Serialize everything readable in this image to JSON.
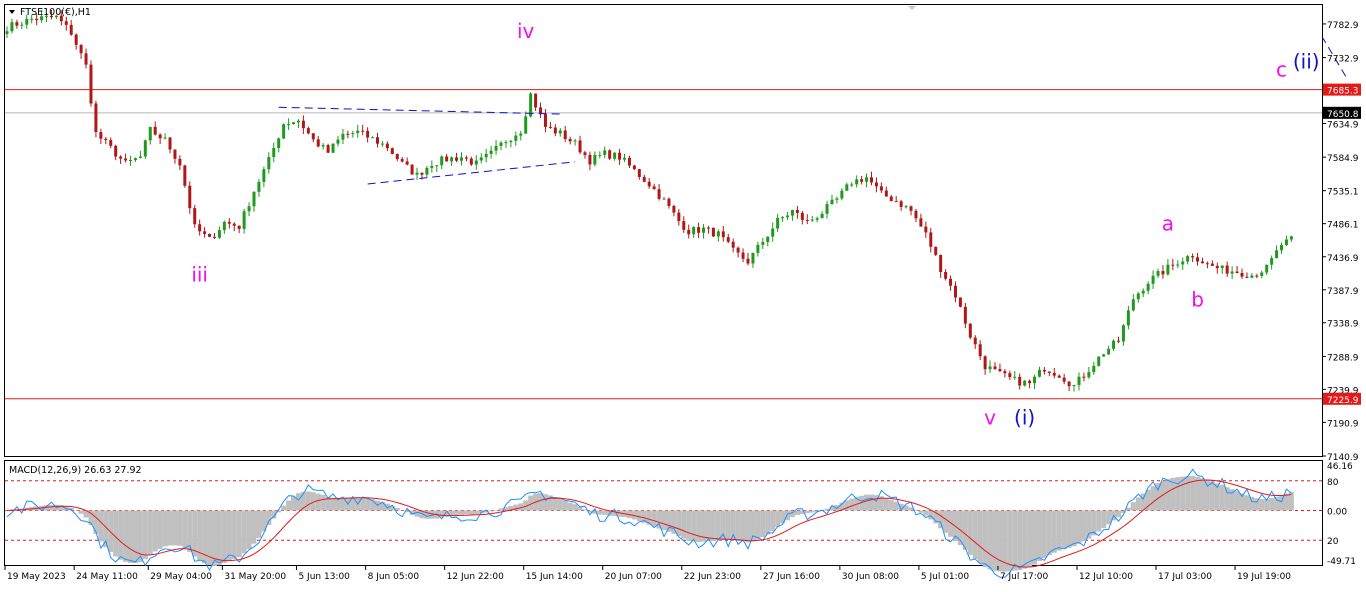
{
  "window": {
    "symbol_label": "FTSE100(€),H1",
    "colors": {
      "background": "#ffffff",
      "frame": "#000000",
      "bull_candle": "#1f9a1f",
      "bear_candle": "#b01818",
      "hline": "#e31a1a",
      "price_line": "#b8b8b8",
      "wave_minor": "#ee10ee",
      "wave_intermediate": "#1010c8",
      "trendline": "#1010c8"
    }
  },
  "chart_data": [
    {
      "type": "candlestick",
      "title": "FTSE100(€),H1",
      "ylim": [
        7140.9,
        7811.0
      ],
      "y_ticks": [
        "7782.9",
        "7732.9",
        "7685.3",
        "7650.8",
        "7634.9",
        "7584.9",
        "7535.1",
        "7486.1",
        "7436.9",
        "7387.9",
        "7338.9",
        "7288.9",
        "7239.9",
        "7225.9",
        "7190.9",
        "7140.9"
      ],
      "price_labels": [
        {
          "value": 7685.3,
          "text": "7685.3",
          "style": "red"
        },
        {
          "value": 7650.8,
          "text": "7650.8",
          "style": "black"
        },
        {
          "value": 7225.9,
          "text": "7225.9",
          "style": "red"
        }
      ],
      "x_tick_labels": [
        "19 May 2023",
        "24 May 11:00",
        "29 May 04:00",
        "31 May 20:00",
        "5 Jun 13:00",
        "8 Jun 05:00",
        "12 Jun 22:00",
        "15 Jun 14:00",
        "20 Jun 07:00",
        "22 Jun 23:00",
        "27 Jun 16:00",
        "30 Jun 08:00",
        "5 Jul 01:00",
        "7 Jul 17:00",
        "12 Jul 10:00",
        "17 Jul 03:00",
        "19 Jul 19:00"
      ],
      "x_tick_index": [
        0,
        14,
        29,
        44,
        59,
        73,
        89,
        105,
        121,
        137,
        153,
        169,
        185,
        201,
        217,
        233,
        249
      ],
      "bar_count": 261,
      "price_path": [
        [
          0,
          7778
        ],
        [
          5,
          7790
        ],
        [
          10,
          7793
        ],
        [
          13,
          7770
        ],
        [
          16,
          7720
        ],
        [
          18,
          7620
        ],
        [
          21,
          7598
        ],
        [
          24,
          7575
        ],
        [
          27,
          7585
        ],
        [
          29,
          7625
        ],
        [
          32,
          7610
        ],
        [
          35,
          7575
        ],
        [
          38,
          7480
        ],
        [
          41,
          7462
        ],
        [
          44,
          7488
        ],
        [
          47,
          7482
        ],
        [
          50,
          7535
        ],
        [
          53,
          7580
        ],
        [
          56,
          7635
        ],
        [
          59,
          7640
        ],
        [
          62,
          7610
        ],
        [
          65,
          7592
        ],
        [
          68,
          7618
        ],
        [
          71,
          7622
        ],
        [
          74,
          7612
        ],
        [
          77,
          7600
        ],
        [
          80,
          7575
        ],
        [
          83,
          7558
        ],
        [
          86,
          7576
        ],
        [
          89,
          7582
        ],
        [
          92,
          7585
        ],
        [
          95,
          7575
        ],
        [
          98,
          7590
        ],
        [
          101,
          7610
        ],
        [
          104,
          7625
        ],
        [
          106,
          7678
        ],
        [
          109,
          7630
        ],
        [
          112,
          7620
        ],
        [
          115,
          7605
        ],
        [
          118,
          7580
        ],
        [
          121,
          7590
        ],
        [
          124,
          7585
        ],
        [
          127,
          7565
        ],
        [
          130,
          7545
        ],
        [
          133,
          7520
        ],
        [
          136,
          7490
        ],
        [
          138,
          7475
        ],
        [
          141,
          7478
        ],
        [
          144,
          7470
        ],
        [
          147,
          7445
        ],
        [
          150,
          7430
        ],
        [
          153,
          7460
        ],
        [
          156,
          7490
        ],
        [
          159,
          7505
        ],
        [
          162,
          7488
        ],
        [
          165,
          7503
        ],
        [
          168,
          7522
        ],
        [
          171,
          7548
        ],
        [
          174,
          7555
        ],
        [
          177,
          7530
        ],
        [
          180,
          7520
        ],
        [
          183,
          7505
        ],
        [
          186,
          7470
        ],
        [
          189,
          7420
        ],
        [
          192,
          7380
        ],
        [
          195,
          7320
        ],
        [
          198,
          7275
        ],
        [
          201,
          7262
        ],
        [
          204,
          7253
        ],
        [
          207,
          7248
        ],
        [
          210,
          7272
        ],
        [
          213,
          7262
        ],
        [
          216,
          7245
        ],
        [
          219,
          7270
        ],
        [
          222,
          7295
        ],
        [
          225,
          7312
        ],
        [
          228,
          7375
        ],
        [
          231,
          7400
        ],
        [
          234,
          7415
        ],
        [
          237,
          7430
        ],
        [
          240,
          7440
        ],
        [
          243,
          7425
        ],
        [
          246,
          7418
        ],
        [
          249,
          7415
        ],
        [
          252,
          7410
        ],
        [
          255,
          7420
        ],
        [
          258,
          7455
        ],
        [
          261,
          7465
        ],
        [
          264,
          7520
        ],
        [
          267,
          7585
        ],
        [
          270,
          7615
        ],
        [
          273,
          7610
        ],
        [
          276,
          7648
        ]
      ],
      "indicator": {
        "type": "macd",
        "label": "MACD(12,26,9) 26.63 27.92",
        "parameters": [
          12,
          26,
          9
        ],
        "macd_value": 26.63,
        "signal_value": 27.92,
        "ylim": [
          -55,
          50
        ],
        "y_tick_labels": [
          "46.16",
          "80",
          "0.00",
          "20",
          "-49.71"
        ],
        "y_tick_values": [
          46.16,
          30,
          0,
          -30,
          -49.71
        ],
        "levels": [
          30,
          0,
          -30
        ]
      },
      "annotations": [
        {
          "text": "iii",
          "bar": 39,
          "price": 7400,
          "color": "magenta"
        },
        {
          "text": "iv",
          "bar": 105,
          "price": 7762,
          "color": "magenta"
        },
        {
          "text": "v",
          "bar": 199,
          "price": 7188,
          "color": "magenta"
        },
        {
          "text": "(i)",
          "bar": 206,
          "price": 7188,
          "color": "blue"
        },
        {
          "text": "a",
          "bar": 235,
          "price": 7476,
          "color": "magenta"
        },
        {
          "text": "b",
          "bar": 241,
          "price": 7363,
          "color": "magenta"
        },
        {
          "text": "c",
          "bar": 258,
          "price": 7705,
          "color": "magenta"
        },
        {
          "text": "(ii)",
          "bar": 263,
          "price": 7717,
          "color": "blue"
        }
      ],
      "trendlines": [
        {
          "from": [
            55,
            7659
          ],
          "to": [
            112,
            7649
          ]
        },
        {
          "from": [
            73,
            7545
          ],
          "to": [
            115,
            7578
          ]
        },
        {
          "from": [
            271,
            7705
          ],
          "to": [
            317,
            7140
          ]
        }
      ]
    }
  ]
}
